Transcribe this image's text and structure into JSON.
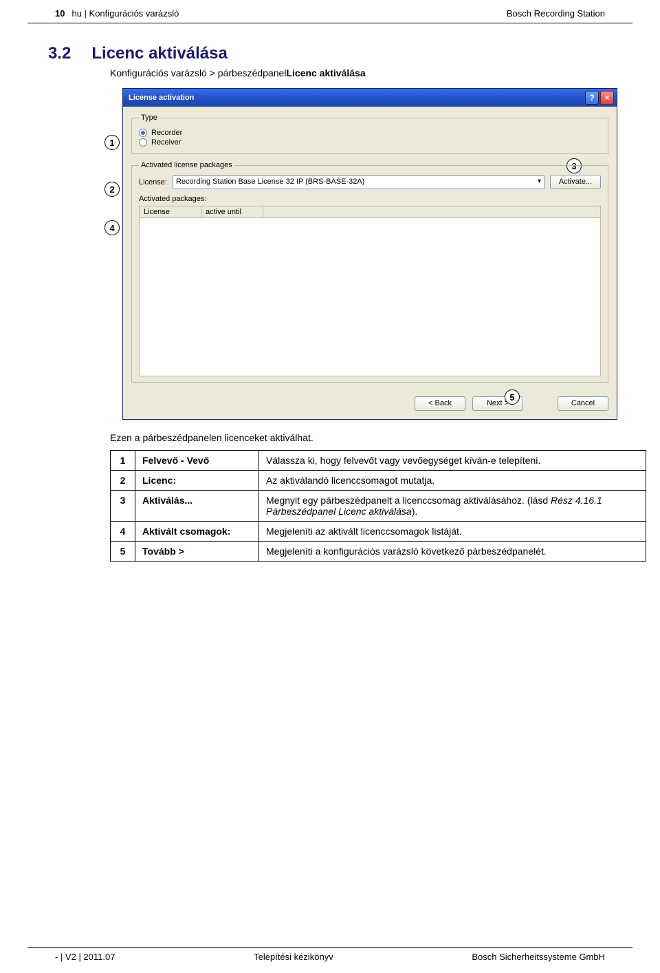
{
  "header": {
    "page_num": "10",
    "lang_crumb": "hu | Konfigurációs varázsló",
    "product": "Bosch Recording Station"
  },
  "section": {
    "num": "3.2",
    "title": "Licenc aktiválása",
    "crumb_prefix": "Konfigurációs varázsló > párbeszédpanel",
    "crumb_leaf": "Licenc aktiválása"
  },
  "dialog": {
    "title": "License activation",
    "type_group": "Type",
    "radio_recorder": "Recorder",
    "radio_receiver": "Receiver",
    "pkg_group": "Activated license packages",
    "license_label": "License:",
    "license_value": "Recording Station Base License 32 IP (BRS-BASE-32A)",
    "activate_btn": "Activate...",
    "activated_label": "Activated packages:",
    "col_license": "License",
    "col_until": "active until",
    "back_btn": "< Back",
    "next_btn": "Next >",
    "cancel_btn": "Cancel"
  },
  "intro": "Ezen a párbeszédpanelen licenceket aktiválhat.",
  "table": {
    "rows": [
      {
        "n": "1",
        "k": "Felvevő - Vevő",
        "v": "Válassza ki, hogy felvevőt vagy vevőegységet kíván-e telepíteni."
      },
      {
        "n": "2",
        "k": "Licenc:",
        "v": "Az aktiválandó licenccsomagot mutatja."
      },
      {
        "n": "3",
        "k": "Aktiválás...",
        "v": "Megnyit egy párbeszédpanelt a licenccsomag aktiválásához (lásd Rész 4.16.1 Párbeszédpanel Licenc aktiválása)."
      },
      {
        "n": "4",
        "k": "Aktivált csomagok:",
        "v": "Megjeleníti az aktivált licenccsomagok listáját."
      },
      {
        "n": "5",
        "k": "Tovább >",
        "v": "Megjeleníti a konfigurációs varázsló következő párbeszédpanelét."
      }
    ]
  },
  "italic_marker": " (lásd Rész 4.16.1 Párbeszédpanel Licenc aktiválása)",
  "footer": {
    "left": "- | V2 | 2011.07",
    "mid": "Telepítési kézikönyv",
    "right": "Bosch Sicherheitssysteme GmbH"
  },
  "callouts": [
    "1",
    "2",
    "3",
    "4",
    "5"
  ]
}
